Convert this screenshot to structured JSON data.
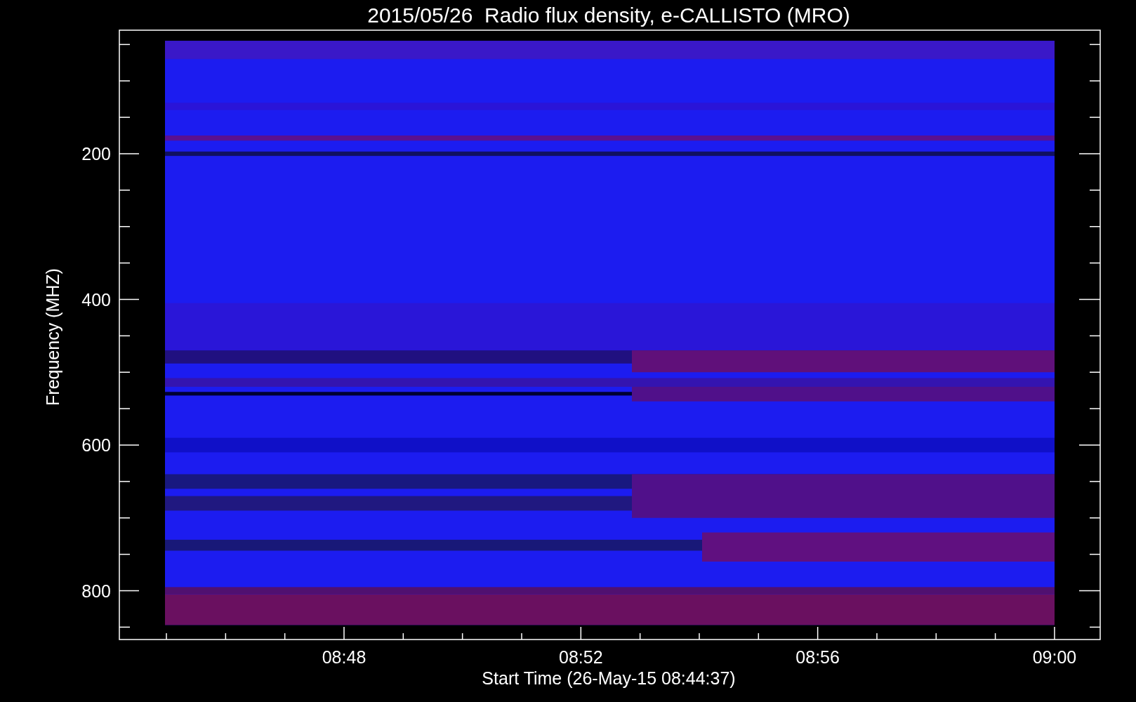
{
  "title": "2015/05/26  Radio flux density, e-CALLISTO (MRO)",
  "y_axis": {
    "label": "Frequency (MHZ)",
    "ticks": [
      "200",
      "400",
      "600",
      "800"
    ]
  },
  "x_axis": {
    "label": "Start Time (26-May-15 08:44:37)",
    "ticks": [
      "08:48",
      "08:52",
      "08:56",
      "09:00"
    ]
  }
}
